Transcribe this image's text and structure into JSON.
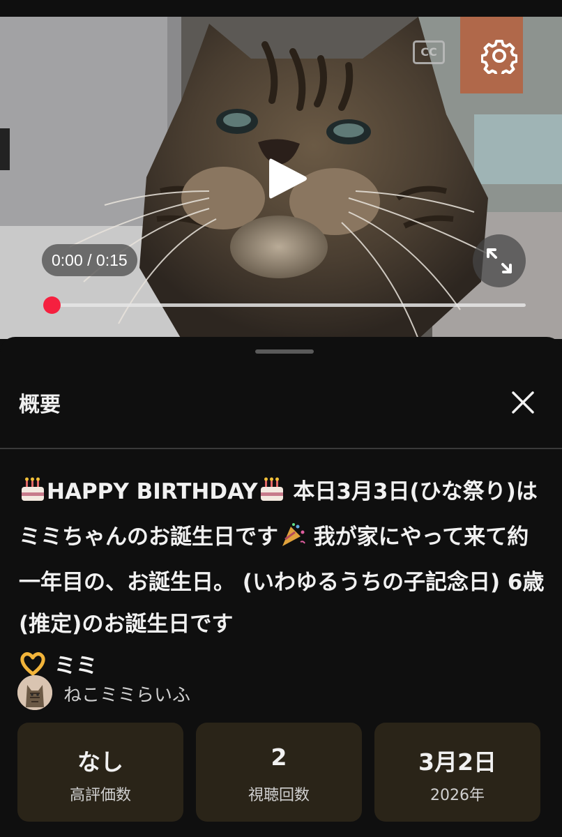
{
  "player": {
    "cc_label": "CC",
    "time_display": "0:00 / 0:15",
    "progress_fraction": 0.0,
    "accent_color": "#ff0033"
  },
  "icons": [
    "cc-icon",
    "gear-icon",
    "play-icon",
    "fullscreen-icon",
    "close-icon",
    "birthday-cake-icon",
    "party-popper-icon",
    "heart-hands-icon"
  ],
  "panel": {
    "title": "概要",
    "description": {
      "part1": "HAPPY BIRTHDAY",
      "part2": " 本日3月3日(ひな祭り)は ミミちゃんのお誕生日です",
      "part3": " 我が家にやって来て約一年目の、お誕生日。 (いわゆるうちの子記念日) 6歳(推定)のお誕生日です",
      "part4": " ミミ"
    },
    "channel_name": "ねこミミらいふ"
  },
  "stats": [
    {
      "value": "なし",
      "label": "高評価数"
    },
    {
      "value": "2",
      "label": "視聴回数"
    },
    {
      "value": "3月2日",
      "label": "2026年"
    }
  ]
}
